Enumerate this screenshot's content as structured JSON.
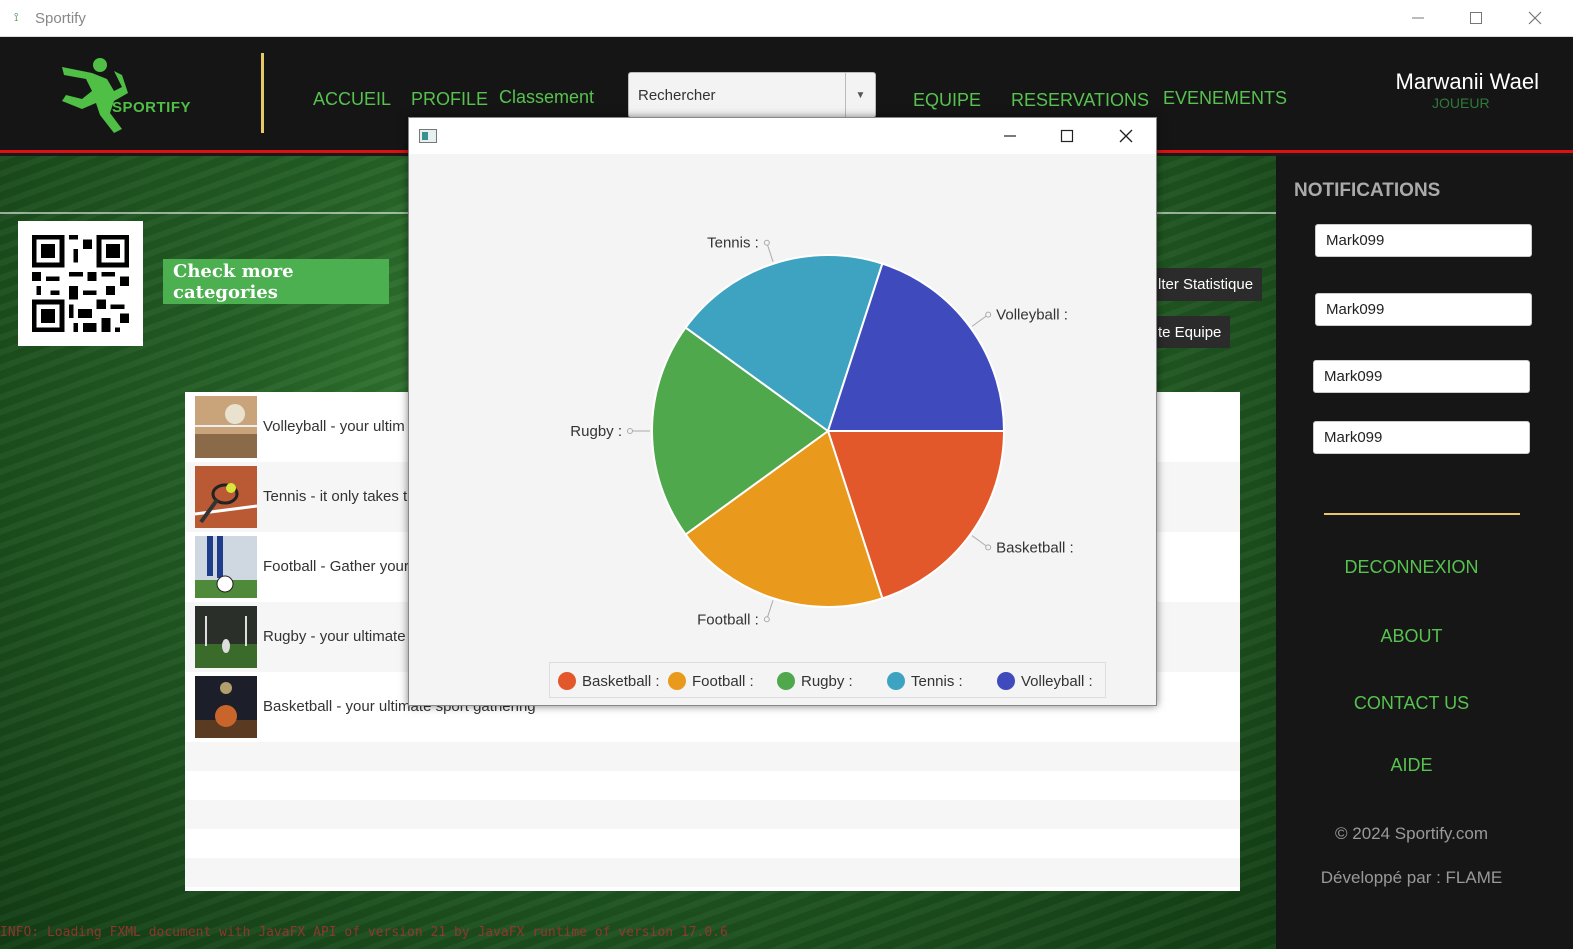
{
  "window": {
    "title": "Sportify"
  },
  "header": {
    "logo_text": "SPORTIFY",
    "nav": [
      "ACCUEIL",
      "PROFILE",
      "Classement",
      "EQUIPE",
      "RESERVATIONS",
      "EVENEMENTS"
    ],
    "search_value": "Rechercher",
    "user_name": "Marwanii Wael",
    "user_role": "JOUEUR"
  },
  "main": {
    "check_button": "Check more categories",
    "side_buttons": [
      "lter Statistique",
      "te Equipe"
    ],
    "list": [
      {
        "label": "Volleyball - your ultim",
        "thumb": "volleyball-thumb"
      },
      {
        "label": "Tennis - it only takes t",
        "thumb": "tennis-thumb"
      },
      {
        "label": "Football - Gather your",
        "thumb": "football-thumb"
      },
      {
        "label": "Rugby - your ultimate",
        "thumb": "rugby-thumb"
      },
      {
        "label": "Basketball - your ultimate sport gathering",
        "thumb": "basketball-thumb"
      }
    ],
    "console": "INFO: Loading FXML document with JavaFX API of version 21 by JavaFX runtime of version 17.0.6"
  },
  "sidebar": {
    "title": "NOTIFICATIONS",
    "notifications": [
      "Mark099",
      "Mark099",
      "Mark099",
      "Mark099"
    ],
    "links": [
      "DECONNEXION",
      "ABOUT",
      "CONTACT US",
      "AIDE"
    ],
    "copyright": "© 2024 Sportify.com",
    "dev": "Développé par :  FLAME"
  },
  "chart_data": {
    "type": "pie",
    "slices": [
      {
        "label": "Basketball  :",
        "value": 20,
        "color": "#e2582b"
      },
      {
        "label": "Football  :",
        "value": 20,
        "color": "#e99a1c"
      },
      {
        "label": "Rugby  :",
        "value": 20,
        "color": "#4fa84c"
      },
      {
        "label": "Tennis  :",
        "value": 20,
        "color": "#3ea3c0"
      },
      {
        "label": "Volleyball  :",
        "value": 20,
        "color": "#3f4bbd"
      }
    ],
    "legend": [
      "Basketball  :",
      "Football  :",
      "Rugby  :",
      "Tennis  :",
      "Volleyball  :"
    ],
    "legend_position": "bottom"
  }
}
